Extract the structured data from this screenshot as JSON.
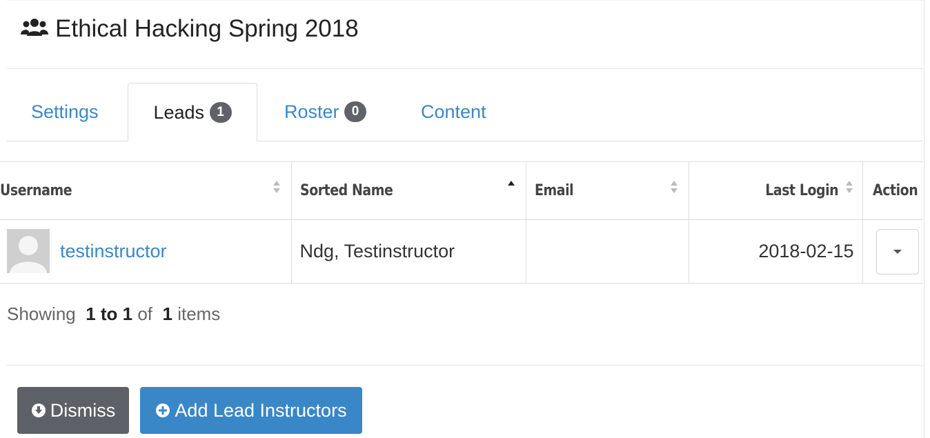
{
  "header": {
    "icon": "users-icon",
    "title": "Ethical Hacking Spring 2018"
  },
  "tabs": [
    {
      "label": "Settings",
      "badge": null,
      "active": false
    },
    {
      "label": "Leads",
      "badge": "1",
      "active": true
    },
    {
      "label": "Roster",
      "badge": "0",
      "active": false
    },
    {
      "label": "Content",
      "badge": null,
      "active": false
    }
  ],
  "table": {
    "columns": [
      "Username",
      "Sorted Name",
      "Email",
      "Last Login",
      "Action"
    ],
    "rows": [
      {
        "username": "testinstructor",
        "sorted_name": "Ndg, Testinstructor",
        "email": "",
        "last_login": "2018-02-15"
      }
    ]
  },
  "pagination": {
    "showing": "Showing",
    "range": "1 to 1",
    "of": "of",
    "total": "1",
    "items": "items"
  },
  "buttons": {
    "dismiss": "Dismiss",
    "add": "Add Lead Instructors"
  },
  "colors": {
    "link": "#3a87c8",
    "badge": "#5f6368",
    "dismiss_button": "#5d6066",
    "add_button": "#3a87c8"
  }
}
